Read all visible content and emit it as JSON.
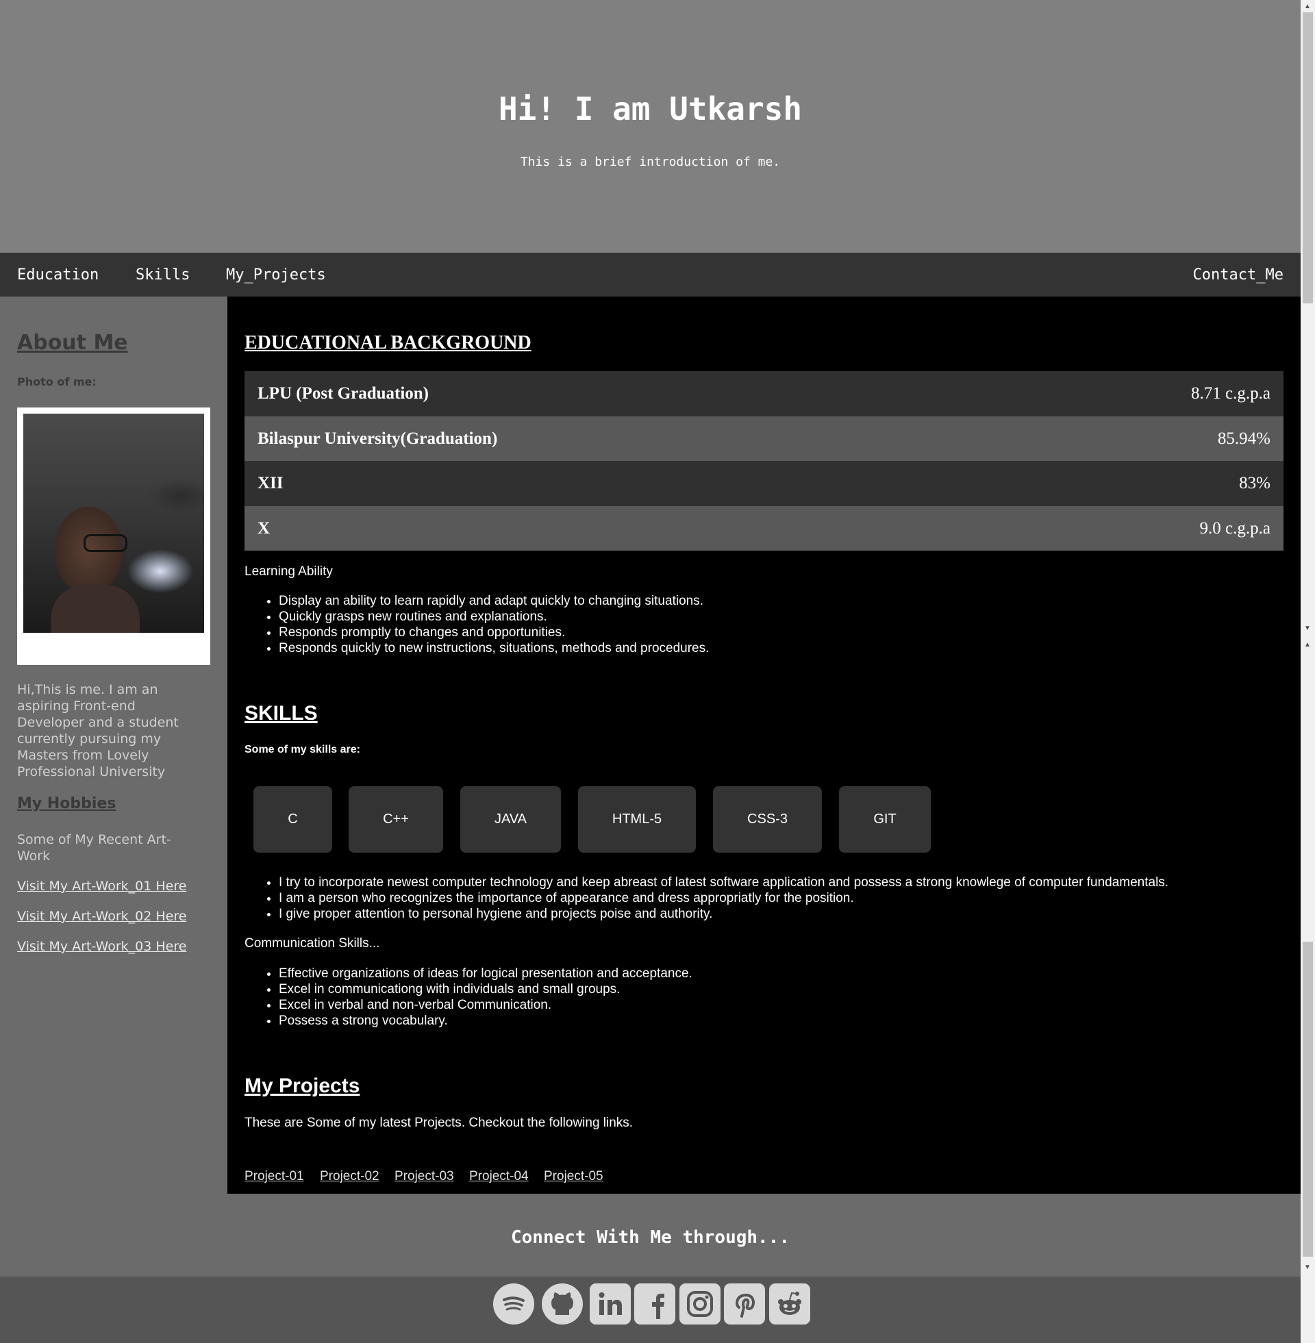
{
  "header": {
    "title": "Hi! I am Utkarsh",
    "subtitle": "This is a brief introduction of me."
  },
  "nav": {
    "education": "Education",
    "skills": "Skills",
    "projects": "My_Projects",
    "contact": "Contact_Me"
  },
  "sidebar": {
    "about_title": "About Me",
    "photo_label": "Photo of me:",
    "intro": "Hi,This is me. I am an aspiring Front-end Developer and a student currently pursuing my Masters from Lovely Professional University",
    "hobbies_title": "My Hobbies",
    "recent": "Some of My Recent Art-Work",
    "art_links": [
      "Visit My Art-Work_01 Here",
      "Visit My Art-Work_02 Here",
      "Visit My Art-Work_03 Here"
    ]
  },
  "education": {
    "title": "EDUCATIONAL BACKGROUND",
    "rows": [
      {
        "name": "LPU (Post Graduation)",
        "score": "8.71 c.g.p.a"
      },
      {
        "name": "Bilaspur University(Graduation)",
        "score": "85.94%"
      },
      {
        "name": "XII",
        "score": "83%"
      },
      {
        "name": "X",
        "score": "9.0 c.g.p.a"
      }
    ],
    "learning_title": "Learning Ability",
    "learning_items": [
      "Display an ability to learn rapidly and adapt quickly to changing situations.",
      "Quickly grasps new routines and explanations.",
      "Responds promptly to changes and opportunities.",
      "Responds quickly to new instructions, situations, methods and procedures."
    ]
  },
  "skills": {
    "title": "SKILLS",
    "subtitle": "Some of my skills are:",
    "chips": [
      "C",
      "C++",
      "JAVA",
      "HTML-5",
      "CSS-3",
      "GIT"
    ],
    "items": [
      "I try to incorporate newest computer technology and keep abreast of latest software application and possess a strong knowlege of computer fundamentals.",
      "I am a person who recognizes the importance of appearance and dress appropriatly for the position.",
      "I give proper attention to personal hygiene and projects poise and authority."
    ],
    "comm_title": "Communication Skills...",
    "comm_items": [
      "Effective organizations of ideas for logical presentation and acceptance.",
      "Excel in communicationg with individuals and small groups.",
      "Excel in verbal and non-verbal Communication.",
      "Possess a strong vocabulary."
    ]
  },
  "projects": {
    "title": "My Projects",
    "text": "These are Some of my latest Projects. Checkout the following links.",
    "links": [
      "Project-01",
      "Project-02",
      "Project-03",
      "Project-04",
      "Project-05"
    ]
  },
  "footer": {
    "connect": "Connect With Me through...",
    "social_icons": [
      "spotify-icon",
      "github-icon",
      "linkedin-icon",
      "facebook-icon",
      "instagram-icon",
      "pinterest-icon",
      "reddit-icon"
    ]
  },
  "colors": {
    "header_bg": "#808080",
    "nav_bg": "#333333",
    "sidebar_bg": "#6b6b6b",
    "main_bg": "#000000",
    "table_dark": "#303030",
    "table_light": "#595959"
  }
}
